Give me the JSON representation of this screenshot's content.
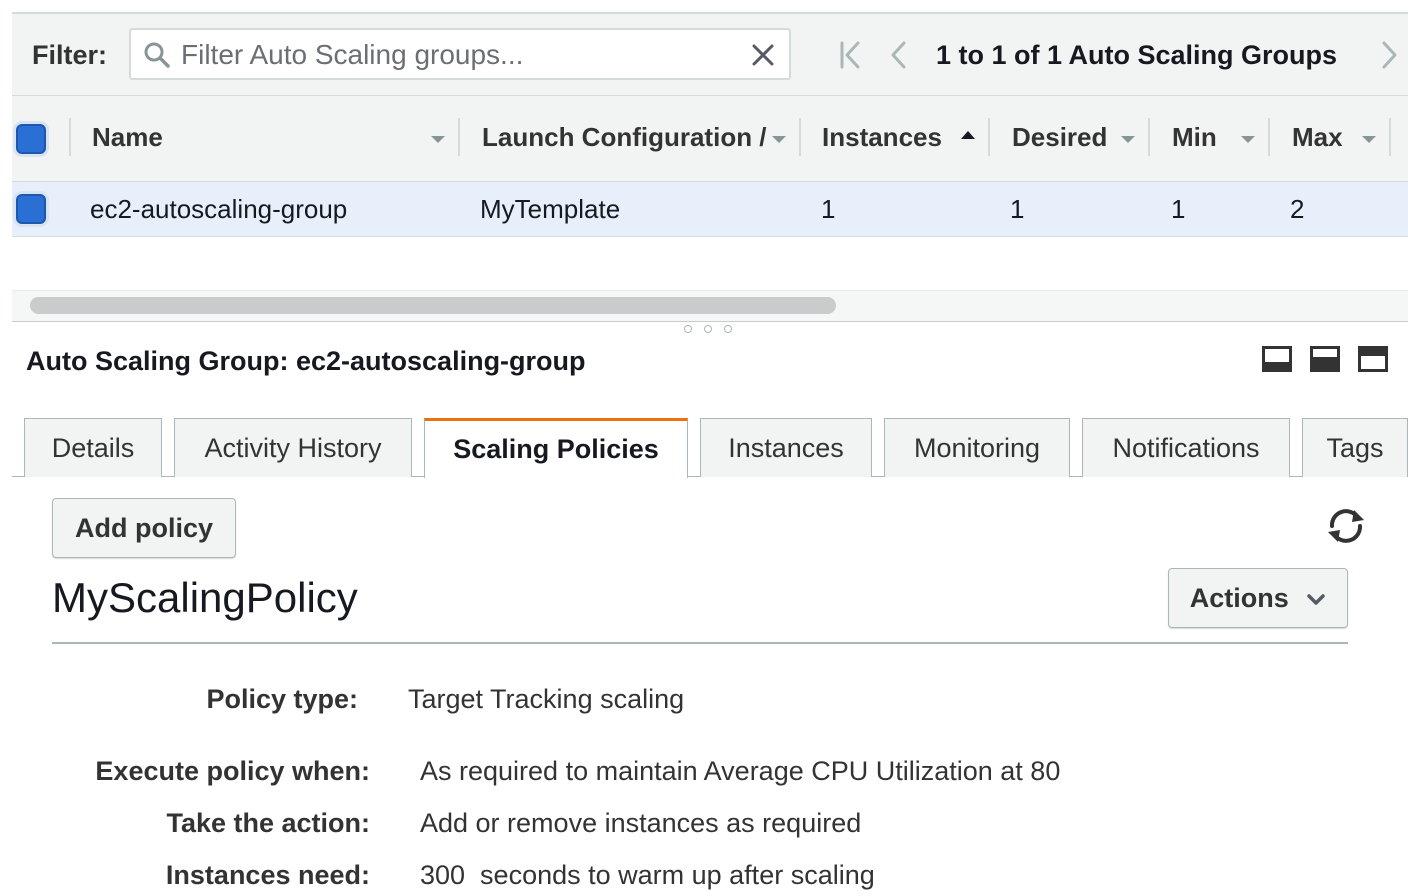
{
  "filter": {
    "label": "Filter:",
    "placeholder": "Filter Auto Scaling groups...",
    "value": ""
  },
  "pagination": {
    "text": "1 to 1 of 1 Auto Scaling Groups"
  },
  "table": {
    "columns": [
      "Name",
      "Launch Configuration /",
      "Instances",
      "Desired",
      "Min",
      "Max"
    ],
    "sorted_column": "Instances",
    "sort_direction": "ascending",
    "rows": [
      {
        "selected": true,
        "cells": [
          "ec2-autoscaling-group",
          "MyTemplate",
          "1",
          "1",
          "1",
          "2"
        ]
      }
    ]
  },
  "details": {
    "title": "Auto Scaling Group: ec2-autoscaling-group",
    "tabs": [
      "Details",
      "Activity History",
      "Scaling Policies",
      "Instances",
      "Monitoring",
      "Notifications",
      "Tags"
    ],
    "active_tab": "Scaling Policies",
    "add_policy_label": "Add policy",
    "actions_label": "Actions",
    "policy": {
      "name": "MyScalingPolicy",
      "fields": [
        {
          "label": "Policy type:",
          "value": "Target Tracking scaling"
        },
        {
          "label": "Execute policy when:",
          "value": "As required to maintain Average CPU Utilization at 80"
        },
        {
          "label": "Take the action:",
          "value": "Add or remove instances as required"
        },
        {
          "label": "Instances need:",
          "value": "300  seconds to warm up after scaling"
        }
      ]
    }
  },
  "colors": {
    "accent_tab": "#ec7211",
    "checkbox": "#2a6fd4",
    "selected_row": "#e7f0fa"
  }
}
